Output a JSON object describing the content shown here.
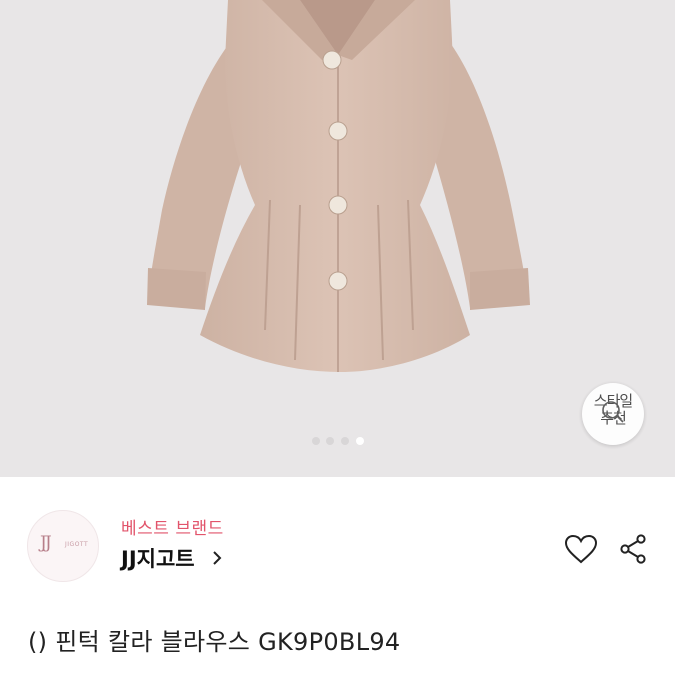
{
  "gallery": {
    "image_alt": "beige pintuck collar blouse",
    "dots_count": 4,
    "active_dot": 3
  },
  "style_badge": {
    "line1": "스타일",
    "line2": "추천"
  },
  "brand": {
    "logo_text": "JJ",
    "logo_sub": "JIGOTT",
    "tag": "베스트 브랜드",
    "name": "JJ지고트"
  },
  "actions": {
    "like_icon": "heart-outline-icon",
    "share_icon": "share-icon"
  },
  "product": {
    "title": "() 핀턱 칼라 블라우스 GK9P0BL94"
  },
  "colors": {
    "accent": "#e2546b",
    "gallery_bg": "#e8e6e7",
    "garment": "#d8beb0"
  }
}
